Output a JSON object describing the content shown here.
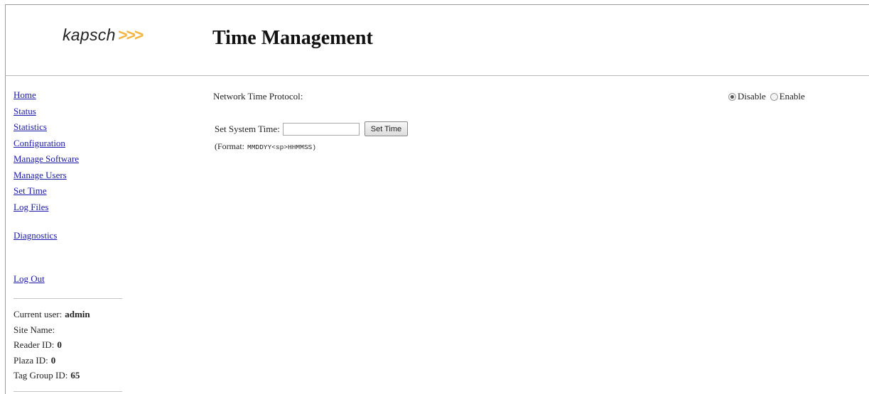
{
  "header": {
    "logo_text": "kapsch",
    "logo_arrows": ">>>",
    "title": "Time Management"
  },
  "nav": [
    {
      "label": "Home"
    },
    {
      "label": "Status"
    },
    {
      "label": "Statistics"
    },
    {
      "label": "Configuration"
    },
    {
      "label": "Manage Software"
    },
    {
      "label": "Manage Users"
    },
    {
      "label": "Set Time"
    },
    {
      "label": "Log Files"
    },
    {
      "label": "Diagnostics"
    },
    {
      "label": "Log Out"
    }
  ],
  "info": {
    "current_user_label": "Current user:",
    "current_user": "admin",
    "site_name_label": "Site Name:",
    "site_name": "",
    "reader_id_label": "Reader ID:",
    "reader_id": "0",
    "plaza_id_label": "Plaza ID:",
    "plaza_id": "0",
    "tag_group_id_label": "Tag Group ID:",
    "tag_group_id": "65"
  },
  "ntp": {
    "label": "Network Time Protocol:",
    "options": [
      {
        "label": "Disable",
        "selected": true
      },
      {
        "label": "Enable",
        "selected": false
      }
    ]
  },
  "set_time": {
    "label": "Set System Time:",
    "value": "",
    "button_label": "Set Time",
    "format_prefix": "(Format:",
    "format_value": "MMDDYY<sp>HHMMSS)"
  },
  "colors": {
    "link": "#1a1aa6",
    "logo_arrow": "#f2b640"
  }
}
